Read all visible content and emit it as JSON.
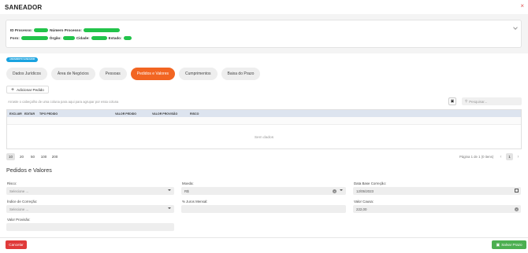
{
  "window": {
    "title": "SANEADOR",
    "close_icon": "×"
  },
  "info": {
    "labels": {
      "id_processo": "ID Processo:",
      "numero_processo": "Número Processo:",
      "foro": "Foro:",
      "orgao": "Órgão:",
      "cidade": "Cidade:",
      "estado": "Estado:"
    },
    "pill_color": "#22c34a"
  },
  "badge": {
    "text": "ANDAMENTO SANEADOR",
    "color": "#1aa3e0"
  },
  "tabs": [
    {
      "label": "Dados Jurídicos"
    },
    {
      "label": "Área de Negócios"
    },
    {
      "label": "Pessoas"
    },
    {
      "label": "Pedidos e Valores",
      "active": true
    },
    {
      "label": "Cumprimentos"
    },
    {
      "label": "Baixa do Prazo"
    }
  ],
  "accent": "#f26522",
  "toolbar": {
    "add_label": "Adicionar Pedido",
    "group_hint": "Arraste o cabeçalho de uma coluna para aqui para agrupar por essa coluna",
    "search_placeholder": "Pesquisar..."
  },
  "grid": {
    "columns": [
      "EXCLUIR",
      "EDITAR",
      "TIPO PEDIDO",
      "VALOR PEDIDO",
      "VALOR PROVISÃO",
      "RISCO"
    ],
    "empty_text": "Sem dados"
  },
  "pager": {
    "sizes": [
      "10",
      "20",
      "50",
      "100",
      "200"
    ],
    "selected": "10",
    "info": "Página 1 de 1 (0 itens)",
    "current_page": "1"
  },
  "form": {
    "title": "Pedidos e Valores",
    "risco": {
      "label": "Risco:",
      "placeholder": "Selecione ..."
    },
    "indice": {
      "label": "Índice de Correção:",
      "placeholder": "Selecione ..."
    },
    "valor_provisao": {
      "label": "Valor Provisão:",
      "value": ""
    },
    "moeda": {
      "label": "Moeda:",
      "value": "R$"
    },
    "juros": {
      "label": "% Juros Mensal:",
      "value": ""
    },
    "data_base": {
      "label": "Data Base Correção:",
      "value": "12/05/2023"
    },
    "valor_causa": {
      "label": "Valor Causa:",
      "value": "222,00"
    }
  },
  "footer": {
    "cancel_label": "Cancelar",
    "save_label": "Salvar Prazo"
  }
}
